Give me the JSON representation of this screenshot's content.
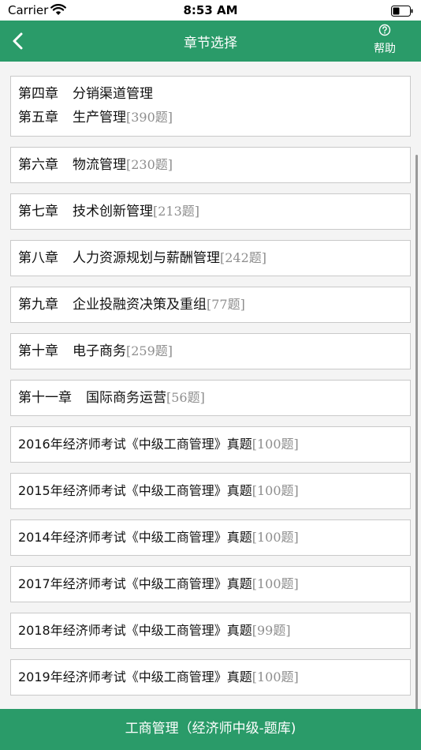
{
  "status_bar": {
    "carrier": "Carrier",
    "time": "8:53 AM"
  },
  "nav": {
    "title": "章节选择",
    "help_label": "帮助"
  },
  "list": {
    "first_item": {
      "line1": {
        "chapter": "第四章",
        "name": "分销渠道管理"
      },
      "line2": {
        "chapter": "第五章",
        "name": "生产管理",
        "count": "[390题]"
      }
    },
    "chapters": [
      {
        "chapter": "第六章",
        "name": "物流管理",
        "count": "[230题]"
      },
      {
        "chapter": "第七章",
        "name": "技术创新管理",
        "count": "[213题]"
      },
      {
        "chapter": "第八章",
        "name": "人力资源规划与薪酬管理",
        "count": "[242题]"
      },
      {
        "chapter": "第九章",
        "name": "企业投融资决策及重组",
        "count": "[77题]"
      },
      {
        "chapter": "第十章",
        "name": "电子商务",
        "count": "[259题]"
      },
      {
        "chapter": "第十一章",
        "name": "国际商务运营",
        "count": "[56题]"
      }
    ],
    "exams": [
      {
        "name": "2016年经济师考试《中级工商管理》真题",
        "count": "[100题]"
      },
      {
        "name": "2015年经济师考试《中级工商管理》真题",
        "count": "[100题]"
      },
      {
        "name": "2014年经济师考试《中级工商管理》真题",
        "count": "[100题]"
      },
      {
        "name": "2017年经济师考试《中级工商管理》真题",
        "count": "[100题]"
      },
      {
        "name": "2018年经济师考试《中级工商管理》真题",
        "count": "[99题]"
      },
      {
        "name": "2019年经济师考试《中级工商管理》真题",
        "count": "[100题]"
      }
    ]
  },
  "footer": {
    "label": "工商管理（经济师中级-题库)"
  },
  "colors": {
    "brand_green": "#2a9b69",
    "count_gray": "#8e8e8e",
    "border_gray": "#c9c9c9"
  }
}
